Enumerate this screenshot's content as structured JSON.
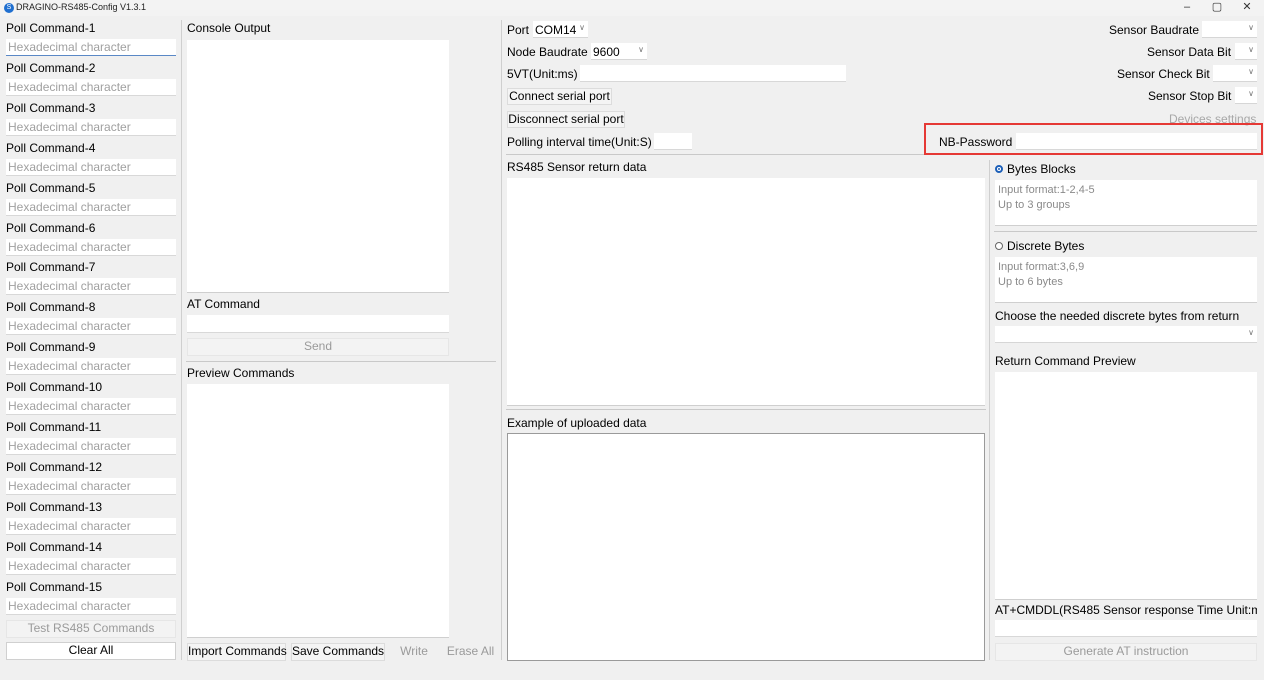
{
  "window": {
    "title": "DRAGINO-RS485-Config V1.3.1",
    "minimize": "–",
    "maximize": "▢",
    "close": "✕"
  },
  "poll": {
    "placeholder": "Hexadecimal character",
    "labels": [
      "Poll Command-1",
      "Poll Command-2",
      "Poll Command-3",
      "Poll Command-4",
      "Poll Command-5",
      "Poll Command-6",
      "Poll Command-7",
      "Poll Command-8",
      "Poll Command-9",
      "Poll Command-10",
      "Poll Command-11",
      "Poll Command-12",
      "Poll Command-13",
      "Poll Command-14",
      "Poll Command-15"
    ],
    "test_button": "Test RS485 Commands",
    "clear_button": "Clear All"
  },
  "console": {
    "title": "Console Output",
    "at_label": "AT Command",
    "send_button": "Send",
    "preview_label": "Preview Commands",
    "import_button": "Import Commands",
    "save_button": "Save Commands",
    "write_button": "Write",
    "erase_button": "Erase All"
  },
  "serial": {
    "port_label": "Port",
    "port_value": "COM14",
    "node_baud_label": "Node Baudrate",
    "node_baud_value": "9600",
    "fivevt_label": "5VT(Unit:ms)",
    "connect_button": "Connect serial port",
    "disconnect_button": "Disconnect serial port",
    "polling_label": "Polling interval time(Unit:S)"
  },
  "sensor": {
    "baudrate_label": "Sensor Baudrate",
    "databit_label": "Sensor Data Bit",
    "checkbit_label": "Sensor Check Bit",
    "stopbit_label": "Sensor Stop Bit",
    "devices_settings": "Devices settings",
    "nb_password_label": "NB-Password"
  },
  "data": {
    "return_label": "RS485 Sensor return data",
    "example_label": "Example of uploaded data"
  },
  "bytes": {
    "blocks_label": "Bytes Blocks",
    "blocks_hint_1": "Input format:1-2,4-5",
    "blocks_hint_2": "Up to 3 groups",
    "discrete_label": "Discrete Bytes",
    "discrete_hint_1": "Input format:3,6,9",
    "discrete_hint_2": "Up to 6 bytes",
    "choose_label": "Choose the needed discrete bytes from return",
    "preview_label": "Return Command Preview",
    "cmddl_label": "AT+CMDDL(RS485 Sensor response Time Unit:m",
    "generate_button": "Generate AT instruction"
  },
  "colors": {
    "highlight": "#e53935",
    "radio_selected": "#1c5fb8",
    "background": "#f0f0f0"
  }
}
